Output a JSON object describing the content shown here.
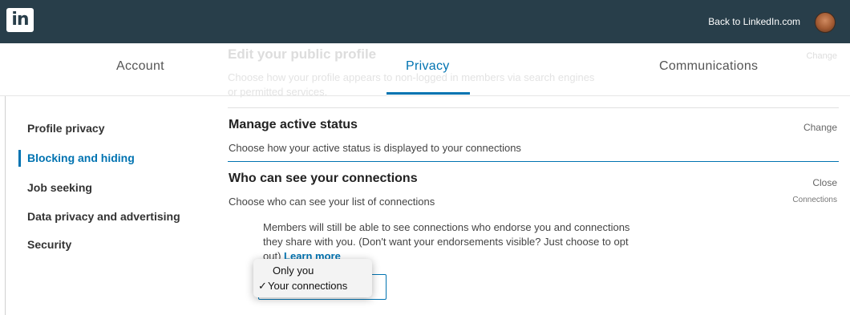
{
  "topbar": {
    "logo_text": "in",
    "back_link": "Back to LinkedIn.com"
  },
  "background_section": {
    "title": "Edit your public profile",
    "description": "Choose how your profile appears to non-logged in members via search engines or permitted services.",
    "action": "Change"
  },
  "tabs": [
    {
      "label": "Account",
      "active": false
    },
    {
      "label": "Privacy",
      "active": true
    },
    {
      "label": "Communications",
      "active": false
    }
  ],
  "sidebar": {
    "items": [
      {
        "label": "Profile privacy",
        "active": false
      },
      {
        "label": "Blocking and hiding",
        "active": true
      },
      {
        "label": "Job seeking",
        "active": false
      },
      {
        "label": "Data privacy and advertising",
        "active": false
      },
      {
        "label": "Security",
        "active": false
      }
    ]
  },
  "sections": [
    {
      "title": "Manage active status",
      "description": "Choose how your active status is displayed to your connections",
      "action": "Change"
    },
    {
      "title": "Who can see your connections",
      "description": "Choose who can see your list of connections",
      "action": "Close",
      "current_value": "Connections"
    }
  ],
  "info": {
    "text": "Members will still be able to see connections who endorse you and connections they share with you. (Don't want your endorsements visible? Just choose to opt out)",
    "learn_more": "Learn more"
  },
  "dropdown": {
    "options": [
      {
        "label": "Only you",
        "selected": false
      },
      {
        "label": "Your connections",
        "selected": true
      }
    ],
    "check_mark": "✓"
  },
  "colors": {
    "topbar": "#283e4a",
    "accent": "#0073b1"
  }
}
